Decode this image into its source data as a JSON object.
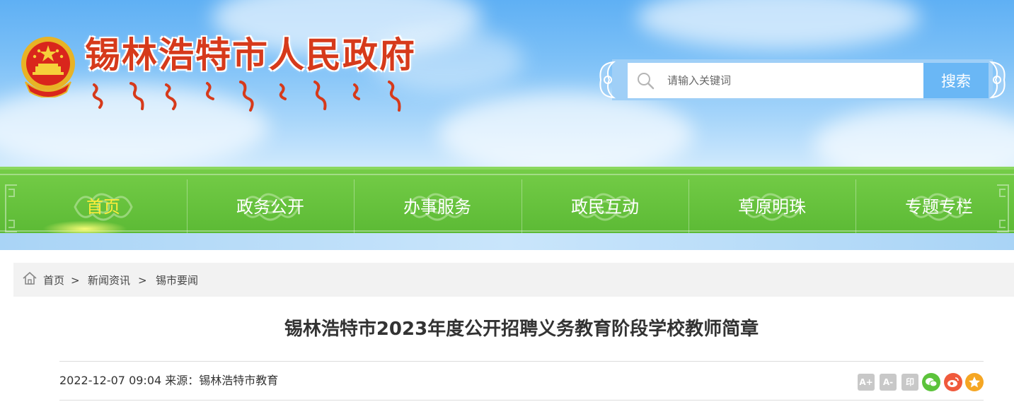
{
  "header": {
    "site_title": "锡林浩特市人民政府",
    "emblem_icon": "national-emblem-icon",
    "mongolian_script_icon": "mongolian-title-script"
  },
  "search": {
    "placeholder": "请输入关键词",
    "button_label": "搜索",
    "icon": "search-icon"
  },
  "nav": {
    "items": [
      {
        "label": "首页",
        "active": true
      },
      {
        "label": "政务公开",
        "active": false
      },
      {
        "label": "办事服务",
        "active": false
      },
      {
        "label": "政民互动",
        "active": false
      },
      {
        "label": "草原明珠",
        "active": false
      },
      {
        "label": "专题专栏",
        "active": false
      }
    ],
    "colors": {
      "bar": "#5cba35",
      "active_text": "#ffec3a",
      "text": "#ffffff"
    }
  },
  "breadcrumb": {
    "icon": "home-icon",
    "items": [
      "首页",
      "新闻资讯",
      "锡市要闻"
    ],
    "separator": ">"
  },
  "article": {
    "title": "锡林浩特市2023年度公开招聘义务教育阶段学校教师简章",
    "meta": "2022-12-07 09:04 来源：锡林浩特市教育",
    "tools": [
      {
        "label": "A+",
        "icon": "font-increase-icon"
      },
      {
        "label": "A-",
        "icon": "font-decrease-icon"
      },
      {
        "label": "印",
        "icon": "print-icon"
      },
      {
        "label": "",
        "icon": "wechat-share-icon",
        "color": "#5cc33b"
      },
      {
        "label": "",
        "icon": "weibo-share-icon",
        "color": "#f05a3c"
      },
      {
        "label": "",
        "icon": "favorite-star-icon",
        "color": "#f5a623"
      }
    ]
  }
}
